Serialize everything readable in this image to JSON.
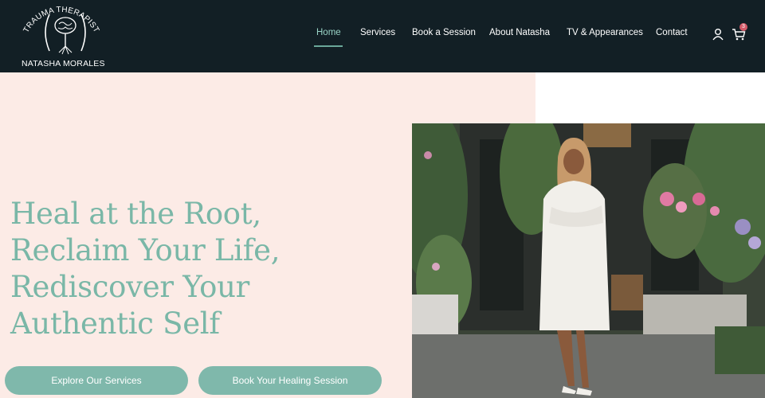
{
  "brand": {
    "arc_text": "TRAUMA THERAPIST",
    "name": "NATASHA MORALES"
  },
  "nav": {
    "items": [
      {
        "label": "Home",
        "active": true
      },
      {
        "label": "Services",
        "active": false
      },
      {
        "label": "Book a Session",
        "active": false
      },
      {
        "label": "About Natasha",
        "active": false
      },
      {
        "label": "TV & Appearances",
        "active": false
      },
      {
        "label": "Contact",
        "active": false
      }
    ],
    "cart_count": "3",
    "icons": [
      "user-icon",
      "cart-icon"
    ]
  },
  "hero": {
    "title_lines": [
      "Heal at the Root,",
      "Reclaim Your Life,",
      "Rediscover Your",
      "Authentic Self"
    ],
    "buttons": {
      "explore": "Explore Our Services",
      "book": "Book Your Healing Session"
    }
  },
  "colors": {
    "header_bg": "#121f25",
    "hero_bg": "#fcebe6",
    "accent_teal": "#7ab7a7",
    "button_teal": "#7fb8ab",
    "badge": "#d45a68"
  }
}
